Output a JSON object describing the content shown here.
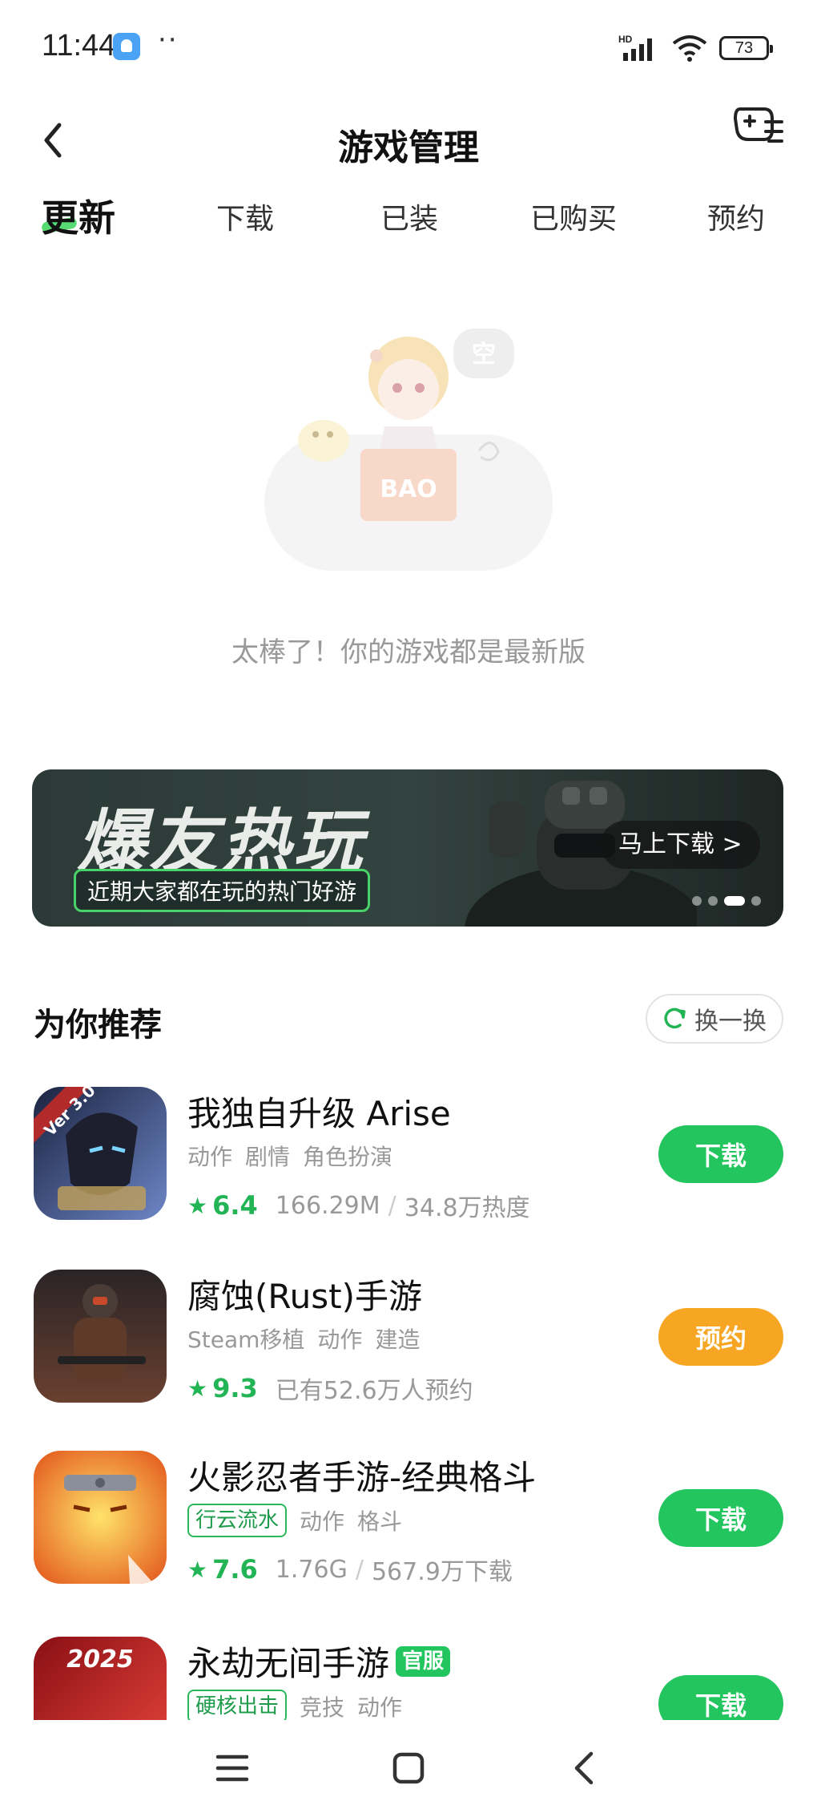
{
  "status_bar": {
    "time": "11:44",
    "dots": "··",
    "network": "HD",
    "battery": "73"
  },
  "header": {
    "title": "游戏管理"
  },
  "tabs": [
    {
      "label": "更新",
      "active": true
    },
    {
      "label": "下载",
      "active": false
    },
    {
      "label": "已装",
      "active": false
    },
    {
      "label": "已购买",
      "active": false
    },
    {
      "label": "预约",
      "active": false
    }
  ],
  "empty_state": {
    "bubble": "空",
    "box_text": "BAO",
    "message": "太棒了！你的游戏都是最新版"
  },
  "banner": {
    "headline": "爆友热玩",
    "subtitle": "近期大家都在玩的热门好游",
    "cta": "马上下载 >",
    "slide_count": 4,
    "active_slide": 3
  },
  "recommend": {
    "title": "为你推荐",
    "refresh_label": "换一换",
    "apps": [
      {
        "name": "我独自升级 Arise",
        "icon_badge": "Ver 3.0",
        "tag_box": "",
        "tags": [
          "动作",
          "剧情",
          "角色扮演"
        ],
        "rating": "6.4",
        "meta1": "166.29M",
        "meta2": "34.8万热度",
        "action": "下载",
        "action_color": "#22c55e",
        "icon_colors": [
          "#2a3550",
          "#5b77b8"
        ]
      },
      {
        "name": "腐蚀(Rust)手游",
        "icon_badge": "",
        "tag_box": "",
        "tags": [
          "Steam移植",
          "动作",
          "建造"
        ],
        "rating": "9.3",
        "meta1": "已有52.6万人预约",
        "meta2": "",
        "action": "预约",
        "action_color": "#f6a623",
        "icon_colors": [
          "#3a2a24",
          "#8a5a3c"
        ]
      },
      {
        "name": "火影忍者手游-经典格斗",
        "icon_badge": "",
        "tag_box": "行云流水",
        "tags": [
          "动作",
          "格斗"
        ],
        "rating": "7.6",
        "meta1": "1.76G",
        "meta2": "567.9万下载",
        "action": "下载",
        "action_color": "#22c55e",
        "icon_colors": [
          "#f08a1c",
          "#ffd24a"
        ]
      },
      {
        "name": "永劫无间手游",
        "official": "官服",
        "icon_badge": "2025",
        "tag_box": "硬核出击",
        "tags": [
          "竞技",
          "动作"
        ],
        "rating": "",
        "meta1": "",
        "meta2": "",
        "action": "下载",
        "action_color": "#22c55e",
        "icon_colors": [
          "#b3181c",
          "#e8453c"
        ]
      }
    ]
  }
}
